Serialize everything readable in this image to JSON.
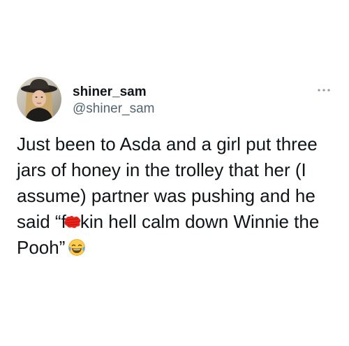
{
  "user": {
    "display_name": "shiner_sam",
    "handle": "@shiner_sam"
  },
  "tweet": {
    "text_before_censor": "Just been to Asda and a girl put three jars of honey in the trolley that her (I assume) partner was pushing and he said “f",
    "text_after_censor": "kin hell calm down Winnie the Pooh”",
    "censor_color": "#e8261e",
    "emoji": "face-with-tears-of-joy"
  },
  "icons": {
    "more": "more-horizontal-icon"
  },
  "colors": {
    "text": "#0f1419",
    "secondary": "#536471",
    "background": "#ffffff"
  }
}
